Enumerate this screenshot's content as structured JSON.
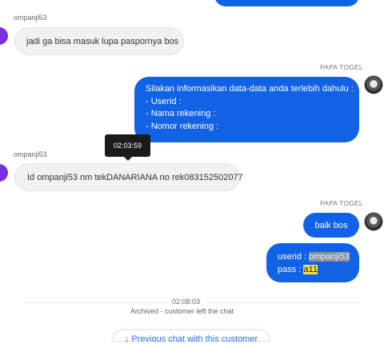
{
  "messages": [
    {
      "sender": "ompanji53",
      "text": "jadi ga bisa masuk lupa paspornya bos"
    },
    {
      "sender": "PAPA TOGEL",
      "lines": [
        "Silakan informasikan data-data anda terlebih dahulu :",
        "- Userid :",
        "- Nama rekening :",
        "- Nomor rekening :"
      ]
    },
    {
      "sender": "ompanji53",
      "text": "Id ompanji53 nm tekDANARIANA no rek083152502077",
      "tooltip_time": "02:03:59"
    },
    {
      "sender": "PAPA TOGEL",
      "text": "baik bos"
    },
    {
      "userid_label": "userid :",
      "userid_value": "ompanji53",
      "pass_label": "pass :",
      "pass_value": "a11"
    }
  ],
  "end_time": "02:08:03",
  "archived_text": "Archived - customer left the chat",
  "previous_chat_label": "↓ Previous chat with this customer",
  "colors": {
    "agent_bubble": "#1262e6",
    "customer_bubble": "#f1f1f3",
    "customer_avatar": "#7b2fe0",
    "link": "#2a6fe8"
  }
}
